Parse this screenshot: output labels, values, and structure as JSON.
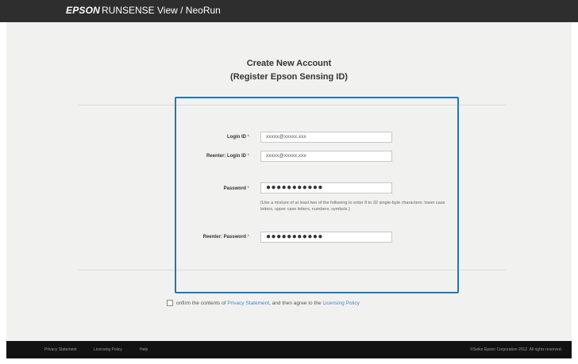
{
  "header": {
    "brand": "EPSON",
    "product": "RUNSENSE View / NeoRun"
  },
  "title": {
    "line1": "Create New Account",
    "line2": "(Register Epson Sensing ID)"
  },
  "form": {
    "required_mark": "*",
    "login_id": {
      "label": "Login ID",
      "value": "xxxxx@xxxxx.xxx"
    },
    "reenter_login_id": {
      "label": "Reenter: Login ID",
      "value": "xxxxx@xxxxx.xxx"
    },
    "password": {
      "label": "Password",
      "value": "●●●●●●●●●●●"
    },
    "password_hint": "(Use a mixture of at least two of the following to enter 8 to 32 single-byte characters: lower case letters, upper case letters, numbers, symbols.)",
    "reenter_password": {
      "label": "Reenter: Password",
      "value": "●●●●●●●●●●●"
    }
  },
  "confirm": {
    "prefix": "onfirm the contents of",
    "privacy_link": "Privacy Statement",
    "middle": ", and then agree to the",
    "policy_link": "Licensing Policy"
  },
  "footer": {
    "privacy": "Privacy Statement",
    "licensing": "Licensing Policy",
    "help": "Help",
    "copyright": "©Seiko Epson Corporation 2012. All rights reserved."
  },
  "colors": {
    "accent": "#1e79b8",
    "link": "#4a86c5",
    "header_bg": "#2e2e2e",
    "footer_bg": "#121212"
  }
}
